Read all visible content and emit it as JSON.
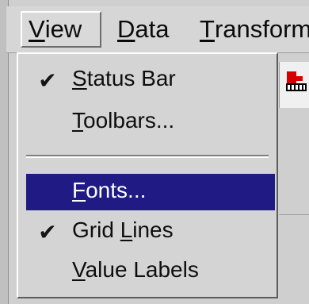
{
  "menubar": {
    "items": [
      {
        "prefix": "",
        "mnemonic": "V",
        "rest": "iew"
      },
      {
        "prefix": "",
        "mnemonic": "D",
        "rest": "ata"
      },
      {
        "prefix": "",
        "mnemonic": "T",
        "rest": "ransform"
      }
    ]
  },
  "view_menu": {
    "items": [
      {
        "check": "✔",
        "prefix": "",
        "mnemonic": "S",
        "rest": "tatus Bar"
      },
      {
        "check": "",
        "prefix": "",
        "mnemonic": "T",
        "rest": "oolbars..."
      },
      {
        "check": "",
        "prefix": "",
        "mnemonic": "F",
        "rest": "onts..."
      },
      {
        "check": "✔",
        "prefix": "Grid ",
        "mnemonic": "L",
        "rest": "ines"
      },
      {
        "check": "",
        "prefix": "",
        "mnemonic": "V",
        "rest": "alue Labels"
      }
    ]
  },
  "colors": {
    "selection": "#1f1a84",
    "menu_background": "#d4d4d4",
    "text": "#0e0e0e"
  },
  "icons": {
    "toolbar_icon": "toolbar-button-icon"
  }
}
